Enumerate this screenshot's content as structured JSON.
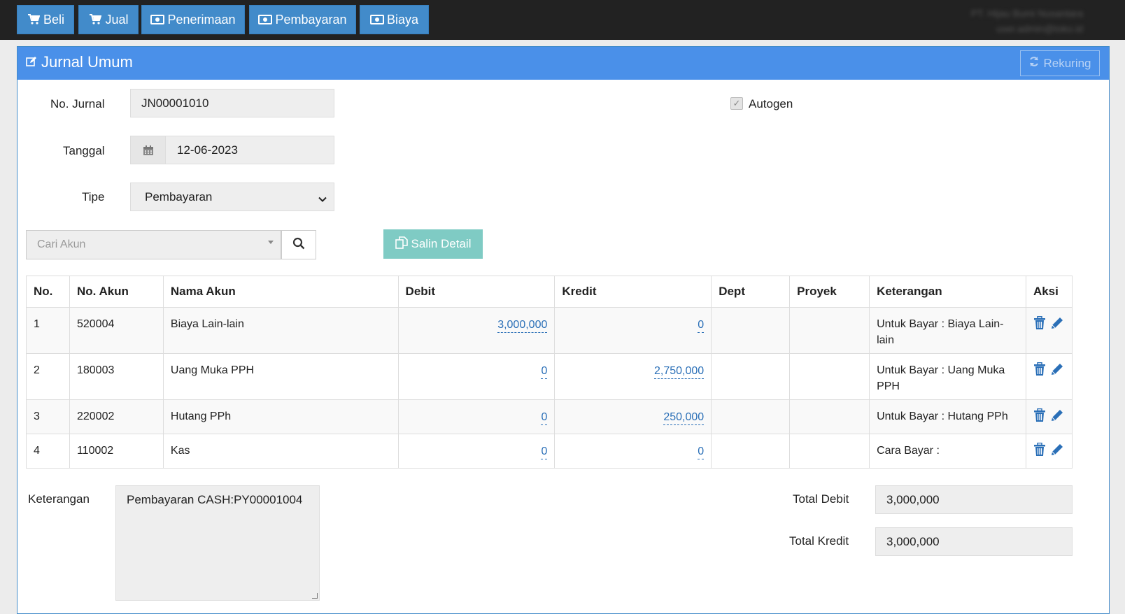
{
  "topbar": {
    "buttons": [
      {
        "label": "Beli",
        "icon": "cart-icon"
      },
      {
        "label": "Jual",
        "icon": "cart-icon"
      },
      {
        "label": "Penerimaan",
        "icon": "money-icon"
      },
      {
        "label": "Pembayaran",
        "icon": "money-icon"
      },
      {
        "label": "Biaya",
        "icon": "money-icon"
      }
    ],
    "user_line1": "PT. Hijau Bumi Nusantara",
    "user_line2": "user.admin@toko.id"
  },
  "panel": {
    "title": "Jurnal Umum",
    "rekuring_label": "Rekuring"
  },
  "form": {
    "no_jurnal_label": "No. Jurnal",
    "no_jurnal_value": "JN00001010",
    "tanggal_label": "Tanggal",
    "tanggal_value": "12-06-2023",
    "tipe_label": "Tipe",
    "tipe_value": "Pembayaran",
    "autogen_label": "Autogen",
    "autogen_checked": true,
    "cari_akun_placeholder": "Cari Akun",
    "salin_detail_label": "Salin Detail"
  },
  "table": {
    "headers": [
      "No.",
      "No. Akun",
      "Nama Akun",
      "Debit",
      "Kredit",
      "Dept",
      "Proyek",
      "Keterangan",
      "Aksi"
    ],
    "rows": [
      {
        "no": "1",
        "akun": "520004",
        "nama": "Biaya Lain-lain",
        "debit": "3,000,000",
        "kredit": "0",
        "dept": "",
        "proyek": "",
        "ket": "Untuk Bayar : Biaya Lain-lain"
      },
      {
        "no": "2",
        "akun": "180003",
        "nama": "Uang Muka PPH",
        "debit": "0",
        "kredit": "2,750,000",
        "dept": "",
        "proyek": "",
        "ket": "Untuk Bayar : Uang Muka PPH"
      },
      {
        "no": "3",
        "akun": "220002",
        "nama": "Hutang PPh",
        "debit": "0",
        "kredit": "250,000",
        "dept": "",
        "proyek": "",
        "ket": "Untuk Bayar : Hutang PPh"
      },
      {
        "no": "4",
        "akun": "110002",
        "nama": "Kas",
        "debit": "0",
        "kredit": "0",
        "dept": "",
        "proyek": "",
        "ket": "Cara Bayar :"
      }
    ]
  },
  "footer": {
    "keterangan_label": "Keterangan",
    "keterangan_value": "Pembayaran CASH:PY00001004",
    "total_debit_label": "Total Debit",
    "total_debit_value": "3,000,000",
    "total_kredit_label": "Total Kredit",
    "total_kredit_value": "3,000,000"
  },
  "colors": {
    "topbar_bg": "#222222",
    "button_blue": "#428bca",
    "panel_header": "#4a90e9",
    "salin_teal": "#7fcbc4",
    "link_blue": "#2a6fb7"
  }
}
